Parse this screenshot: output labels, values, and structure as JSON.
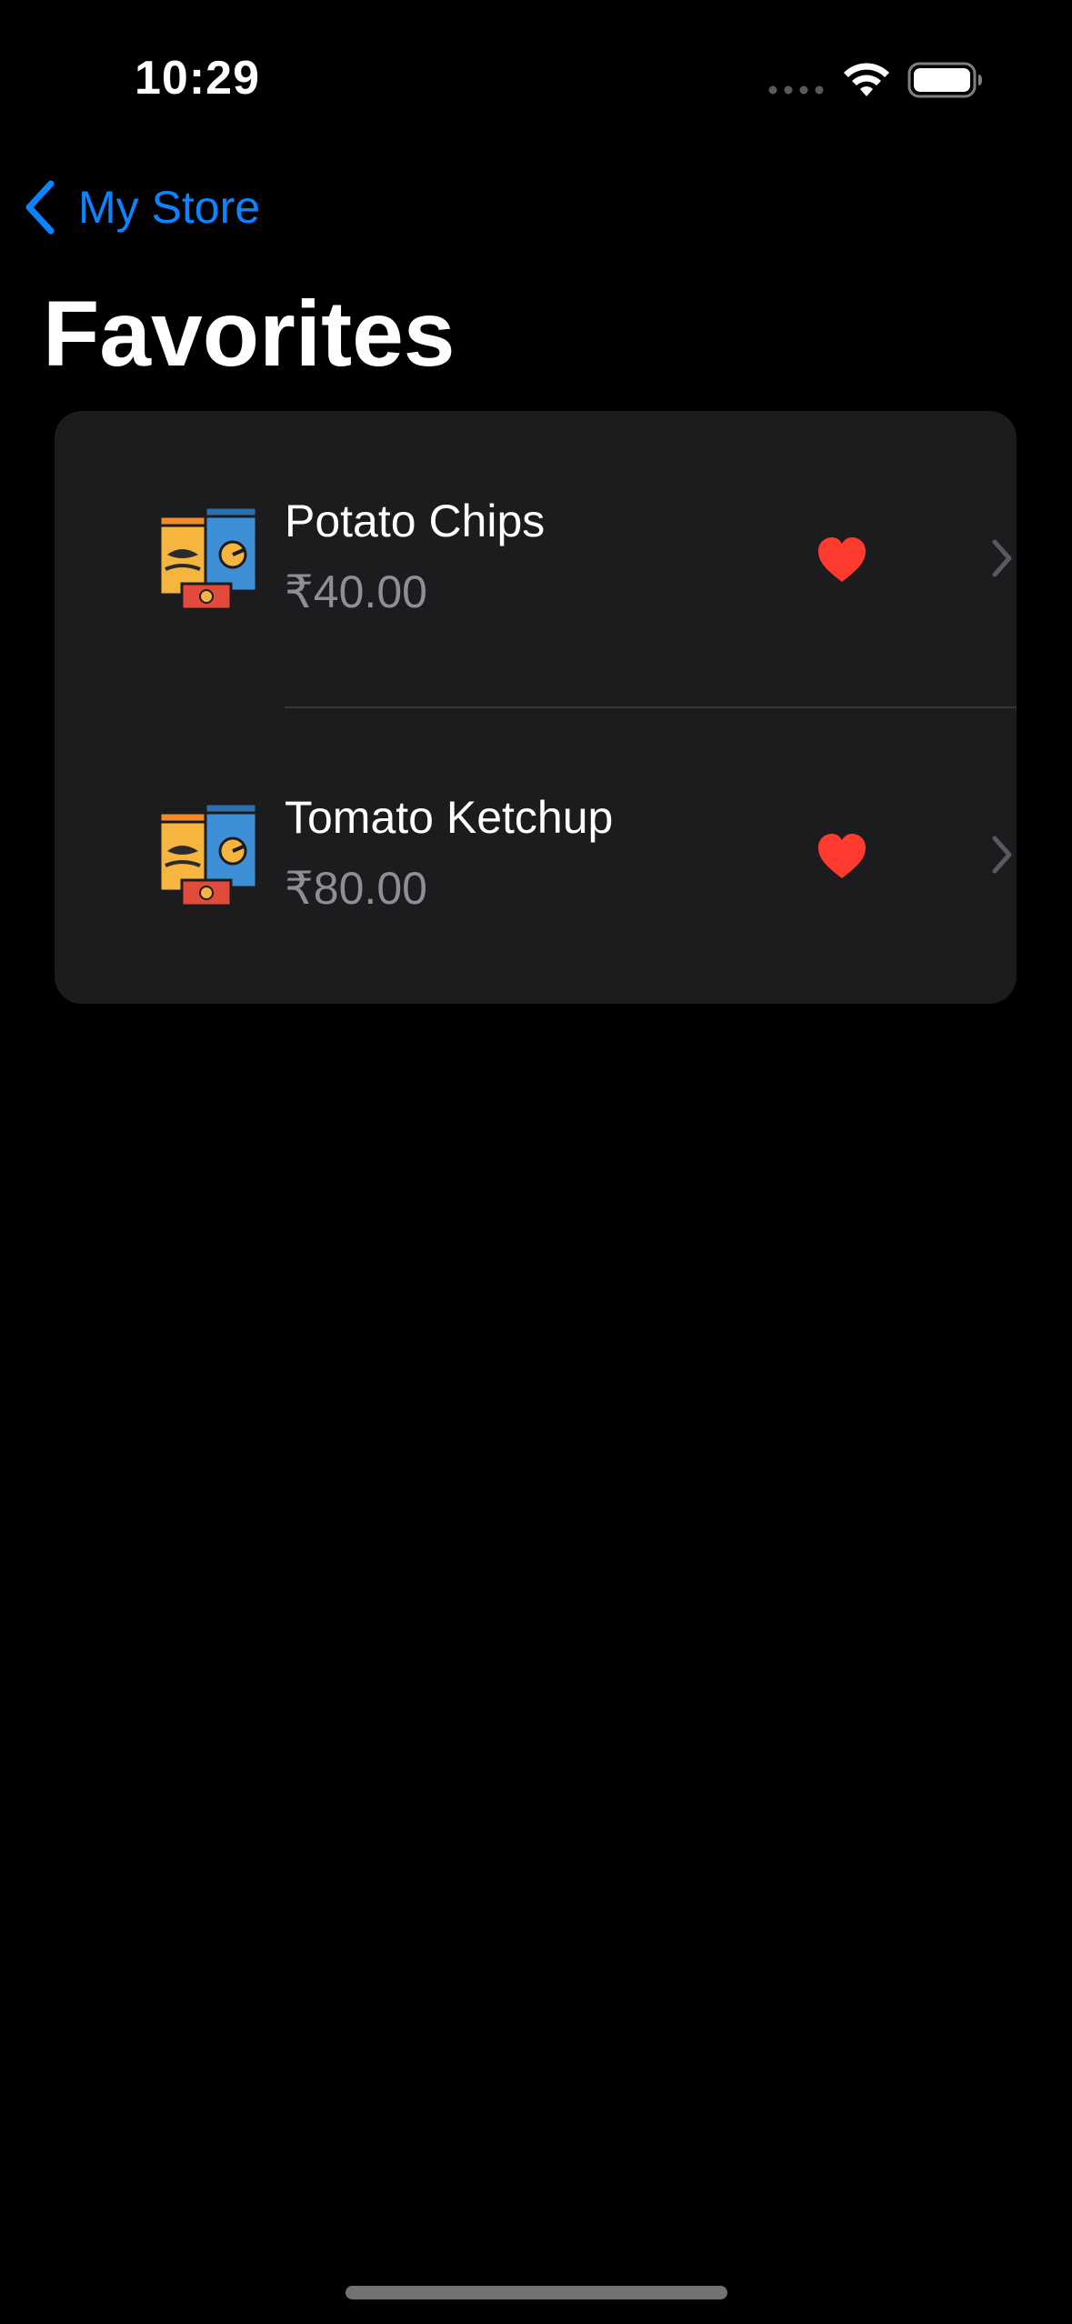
{
  "status_bar": {
    "time": "10:29",
    "signal_icon": "signal-dots-icon",
    "wifi_icon": "wifi-icon",
    "battery_icon": "battery-icon"
  },
  "nav": {
    "back_label": "My Store",
    "back_icon": "chevron-left-icon"
  },
  "page": {
    "title": "Favorites"
  },
  "favorites": [
    {
      "name": "Potato Chips",
      "price": "₹40.00",
      "icon": "snack-bags-icon",
      "favorite_icon": "heart-icon",
      "disclosure_icon": "chevron-right-icon"
    },
    {
      "name": "Tomato Ketchup",
      "price": "₹80.00",
      "icon": "snack-bags-icon",
      "favorite_icon": "heart-icon",
      "disclosure_icon": "chevron-right-icon"
    }
  ],
  "colors": {
    "background": "#000000",
    "card": "#1c1c1e",
    "accent": "#0a84ff",
    "heart": "#ff3b30",
    "secondary_text": "#8e8e93"
  }
}
